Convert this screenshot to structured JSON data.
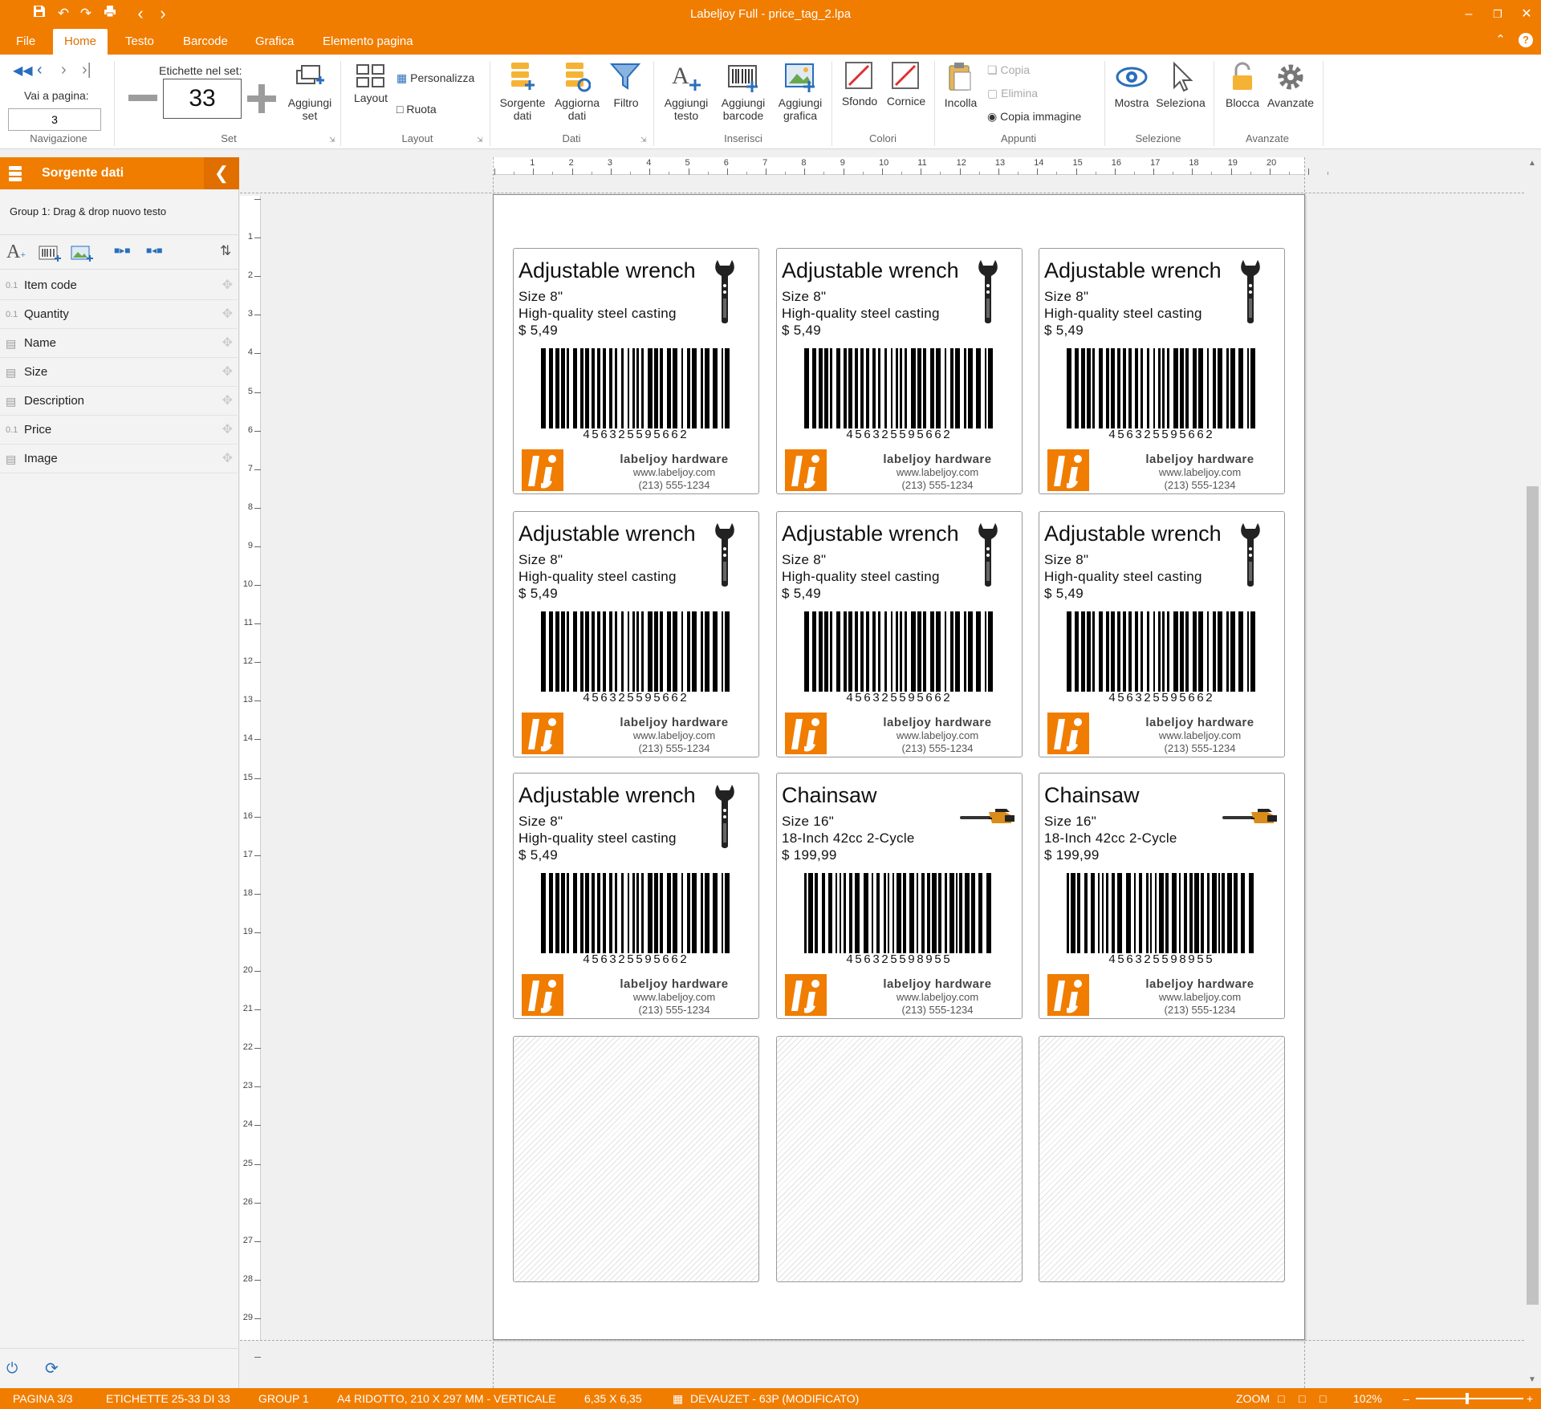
{
  "window": {
    "title": "Labeljoy Full - price_tag_2.lpa"
  },
  "tabs": [
    {
      "label": "File"
    },
    {
      "label": "Home"
    },
    {
      "label": "Testo"
    },
    {
      "label": "Barcode"
    },
    {
      "label": "Grafica"
    },
    {
      "label": "Elemento pagina"
    }
  ],
  "ribbon": {
    "nav": {
      "goto_label": "Vai a pagina:",
      "page_value": "3",
      "group": "Navigazione"
    },
    "set": {
      "count_label": "Etichette nel set:",
      "count_value": "33",
      "add_label": "Aggiungi set",
      "group": "Set"
    },
    "layout": {
      "layout_label": "Layout",
      "customize_label": "Personalizza",
      "rotate_label": "Ruota",
      "group": "Layout"
    },
    "data": {
      "source_label": "Sorgente dati",
      "update_label": "Aggiorna dati",
      "filter_label": "Filtro",
      "group": "Dati"
    },
    "insert": {
      "text_label": "Aggiungi testo",
      "barcode_label": "Aggiungi barcode",
      "graphic_label": "Aggiungi grafica",
      "group": "Inserisci"
    },
    "colors": {
      "background_label": "Sfondo",
      "frame_label": "Cornice",
      "group": "Colori"
    },
    "clipboard": {
      "paste_label": "Incolla",
      "copy_label": "Copia",
      "delete_label": "Elimina",
      "copy_image_label": "Copia immagine",
      "group": "Appunti"
    },
    "selection": {
      "show_label": "Mostra",
      "select_label": "Seleziona",
      "group": "Selezione"
    },
    "advanced": {
      "lock_label": "Blocca",
      "advanced_label": "Avanzate",
      "group": "Avanzate"
    }
  },
  "left_panel": {
    "title": "Sorgente dati",
    "group_text": "Group 1: Drag & drop nuovo testo",
    "fields": [
      {
        "icon": "0.1",
        "name": "Item code"
      },
      {
        "icon": "0.1",
        "name": "Quantity"
      },
      {
        "icon": "doc",
        "name": "Name"
      },
      {
        "icon": "doc",
        "name": "Size"
      },
      {
        "icon": "doc",
        "name": "Description"
      },
      {
        "icon": "0.1",
        "name": "Price"
      },
      {
        "icon": "doc",
        "name": "Image"
      }
    ]
  },
  "labels": [
    {
      "name": "Adjustable wrench",
      "size": "Size 8\"",
      "desc": "High-quality steel casting",
      "price": "$ 5,49",
      "code": "456325595662",
      "image": "wrench"
    },
    {
      "name": "Adjustable wrench",
      "size": "Size 8\"",
      "desc": "High-quality steel casting",
      "price": "$ 5,49",
      "code": "456325595662",
      "image": "wrench"
    },
    {
      "name": "Adjustable wrench",
      "size": "Size 8\"",
      "desc": "High-quality steel casting",
      "price": "$ 5,49",
      "code": "456325595662",
      "image": "wrench"
    },
    {
      "name": "Adjustable wrench",
      "size": "Size 8\"",
      "desc": "High-quality steel casting",
      "price": "$ 5,49",
      "code": "456325595662",
      "image": "wrench"
    },
    {
      "name": "Adjustable wrench",
      "size": "Size 8\"",
      "desc": "High-quality steel casting",
      "price": "$ 5,49",
      "code": "456325595662",
      "image": "wrench"
    },
    {
      "name": "Adjustable wrench",
      "size": "Size 8\"",
      "desc": "High-quality steel casting",
      "price": "$ 5,49",
      "code": "456325595662",
      "image": "wrench"
    },
    {
      "name": "Adjustable wrench",
      "size": "Size 8\"",
      "desc": "High-quality steel casting",
      "price": "$ 5,49",
      "code": "456325595662",
      "image": "wrench"
    },
    {
      "name": "Chainsaw",
      "size": "Size 16\"",
      "desc": "18-Inch 42cc 2-Cycle",
      "price": "$ 199,99",
      "code": "456325598955",
      "image": "chainsaw"
    },
    {
      "name": "Chainsaw",
      "size": "Size 16\"",
      "desc": "18-Inch 42cc 2-Cycle",
      "price": "$ 199,99",
      "code": "456325598955",
      "image": "chainsaw"
    }
  ],
  "empty_labels": 3,
  "footer": {
    "brand": "labeljoy hardware",
    "web": "www.labeljoy.com",
    "phone": "(213) 555-1234"
  },
  "status": {
    "page": "PAGINA 3/3",
    "labels": "ETICHETTE 25-33 DI 33",
    "group": "GROUP 1",
    "paper": "A4 RIDOTTO, 210 X 297 MM - VERTICALE",
    "size": "6,35 X 6,35",
    "template": "DEVAUZET - 63P (MODIFICATO)",
    "zoom_label": "ZOOM",
    "zoom_value": "102%"
  },
  "colors": {
    "accent": "#f07d00",
    "accent_dark": "#e06f00"
  }
}
